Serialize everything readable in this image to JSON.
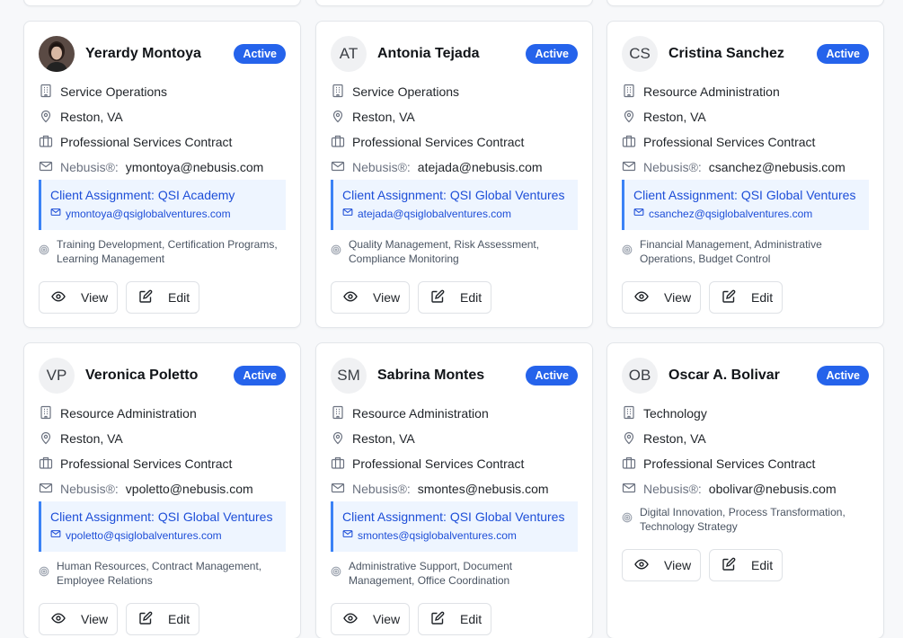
{
  "labels": {
    "nebusis": "Nebusis®:",
    "view": "View",
    "edit": "Edit",
    "assignment_prefix": "Client Assignment: "
  },
  "cards": [
    {
      "name": "Yerardy Montoya",
      "avatar": "",
      "has_photo": true,
      "status": "Active",
      "department": "Service Operations",
      "location": "Reston, VA",
      "contract": "Professional Services Contract",
      "nebusis_email": "ymontoya@nebusis.com",
      "assignment": "Client Assignment: QSI Academy",
      "assignment_email": "ymontoya@qsiglobalventures.com",
      "skills": "Training Development, Certification Programs, Learning Management"
    },
    {
      "name": "Antonia Tejada",
      "avatar": "AT",
      "status": "Active",
      "department": "Service Operations",
      "location": "Reston, VA",
      "contract": "Professional Services Contract",
      "nebusis_email": "atejada@nebusis.com",
      "assignment": "Client Assignment: QSI Global Ventures",
      "assignment_email": "atejada@qsiglobalventures.com",
      "skills": "Quality Management, Risk Assessment, Compliance Monitoring"
    },
    {
      "name": "Cristina Sanchez",
      "avatar": "CS",
      "status": "Active",
      "department": "Resource Administration",
      "location": "Reston, VA",
      "contract": "Professional Services Contract",
      "nebusis_email": "csanchez@nebusis.com",
      "assignment": "Client Assignment: QSI Global Ventures",
      "assignment_email": "csanchez@qsiglobalventures.com",
      "skills": "Financial Management, Administrative Operations, Budget Control"
    },
    {
      "name": "Veronica Poletto",
      "avatar": "VP",
      "status": "Active",
      "department": "Resource Administration",
      "location": "Reston, VA",
      "contract": "Professional Services Contract",
      "nebusis_email": "vpoletto@nebusis.com",
      "assignment": "Client Assignment: QSI Global Ventures",
      "assignment_email": "vpoletto@qsiglobalventures.com",
      "skills": "Human Resources, Contract Management, Employee Relations"
    },
    {
      "name": "Sabrina Montes",
      "avatar": "SM",
      "status": "Active",
      "department": "Resource Administration",
      "location": "Reston, VA",
      "contract": "Professional Services Contract",
      "nebusis_email": "smontes@nebusis.com",
      "assignment": "Client Assignment: QSI Global Ventures",
      "assignment_email": "smontes@qsiglobalventures.com",
      "skills": "Administrative Support, Document Management, Office Coordination"
    },
    {
      "name": "Oscar A. Bolivar",
      "avatar": "OB",
      "status": "Active",
      "department": "Technology",
      "location": "Reston, VA",
      "contract": "Professional Services Contract",
      "nebusis_email": "obolivar@nebusis.com",
      "assignment": "",
      "assignment_email": "",
      "skills": "Digital Innovation, Process Transformation, Technology Strategy"
    }
  ]
}
